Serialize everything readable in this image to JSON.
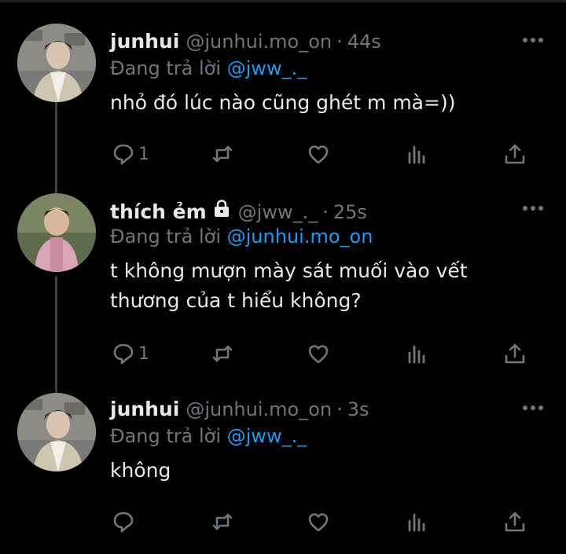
{
  "colors": {
    "background": "#000000",
    "text": "#e7e9ea",
    "muted": "#71767b",
    "link": "#1d9bf0",
    "thread_line": "#3e4144"
  },
  "tweets": [
    {
      "name": "junhui",
      "handle": "@junhui.mo_on",
      "separator": "·",
      "time": "44s",
      "reply_prefix": "Đang trả lời ",
      "reply_to": "@jww_._",
      "text": "nhỏ đó lúc nào cũng ghét m mà=))",
      "reply_count": "1",
      "locked": false,
      "avatar_icon": "avatar-photo-icon"
    },
    {
      "name": "thích ẻm",
      "handle": "@jww_._",
      "separator": "·",
      "time": "25s",
      "reply_prefix": "Đang trả lời ",
      "reply_to": "@junhui.mo_on",
      "text": "t không mượn mày sát muối vào vết thương của t hiểu không?",
      "reply_count": "1",
      "locked": true,
      "avatar_icon": "avatar-photo-icon"
    },
    {
      "name": "junhui",
      "handle": "@junhui.mo_on",
      "separator": "·",
      "time": "3s",
      "reply_prefix": "Đang trả lời ",
      "reply_to": "@jww_._",
      "text": "không",
      "reply_count": "",
      "locked": false,
      "avatar_icon": "avatar-photo-icon"
    }
  ],
  "icons": [
    "more-icon",
    "reply-icon",
    "retweet-icon",
    "like-icon",
    "views-icon",
    "share-icon",
    "lock-icon"
  ]
}
